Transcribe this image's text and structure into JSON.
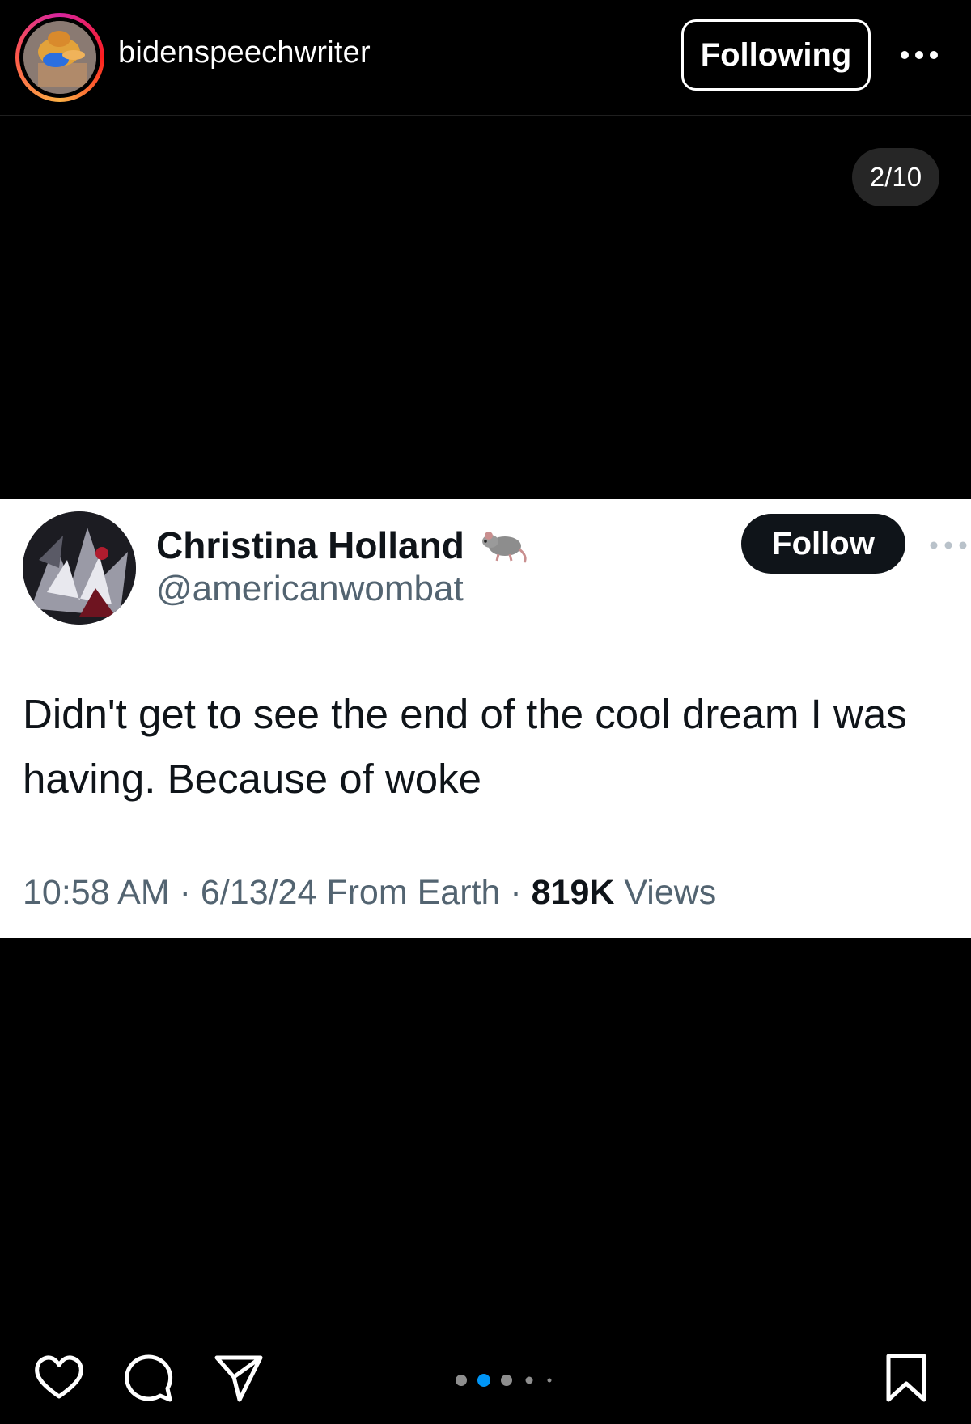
{
  "header": {
    "username": "bidenspeechwriter",
    "following_label": "Following",
    "avatar_icon": "duck-avatar",
    "more_icon": "more-horizontal-icon"
  },
  "carousel": {
    "counter": "2/10",
    "current_index": 2,
    "total": 10,
    "active_dot_color": "#0095f6"
  },
  "tweet": {
    "display_name": "Christina Holland",
    "name_emoji": "rat-emoji",
    "handle": "@americanwombat",
    "follow_label": "Follow",
    "text": "Didn't get to see the end of the cool dream I was having. Because of woke",
    "time": "10:58 AM",
    "sep1": "·",
    "date_source": "6/13/24 From Earth",
    "sep2": "·",
    "views_count": "819K",
    "views_label": "Views"
  },
  "actions": {
    "like_icon": "heart-icon",
    "comment_icon": "comment-icon",
    "share_icon": "paper-plane-icon",
    "save_icon": "bookmark-icon"
  },
  "colors": {
    "background": "#000000",
    "tweet_bg": "#ffffff",
    "tweet_text": "#0f1419",
    "tweet_secondary": "#536471",
    "counter_bg": "#262626"
  }
}
